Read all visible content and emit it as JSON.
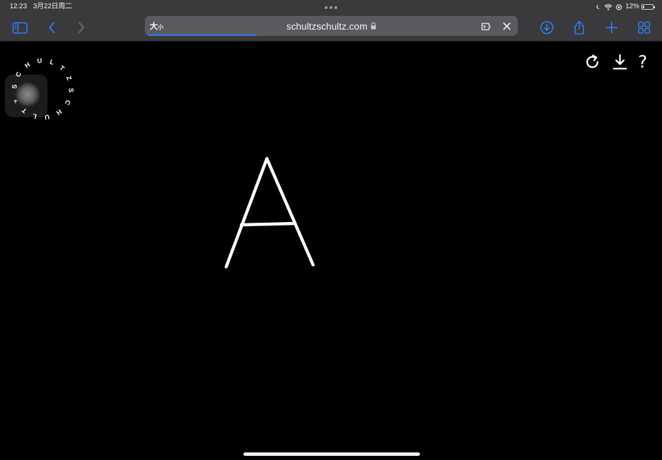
{
  "status_bar": {
    "time": "12:23",
    "date": "3月22日周二",
    "battery": "12%",
    "battery_level": 0.12
  },
  "toolbar": {
    "page_settings_large": "大",
    "page_settings_small": "小",
    "url": "schultzschultz.com",
    "load_progress": 0.3
  },
  "page": {
    "logo_text": "SCHULTZSCHULTZ",
    "help_label": "?"
  },
  "drawing": {
    "glyph": "A",
    "stroke_color": "#ffffff"
  },
  "colors": {
    "accent": "#2f7cf6",
    "chrome": "#3a3a3c",
    "address_bar": "#5a5a5e",
    "background": "#000000"
  }
}
